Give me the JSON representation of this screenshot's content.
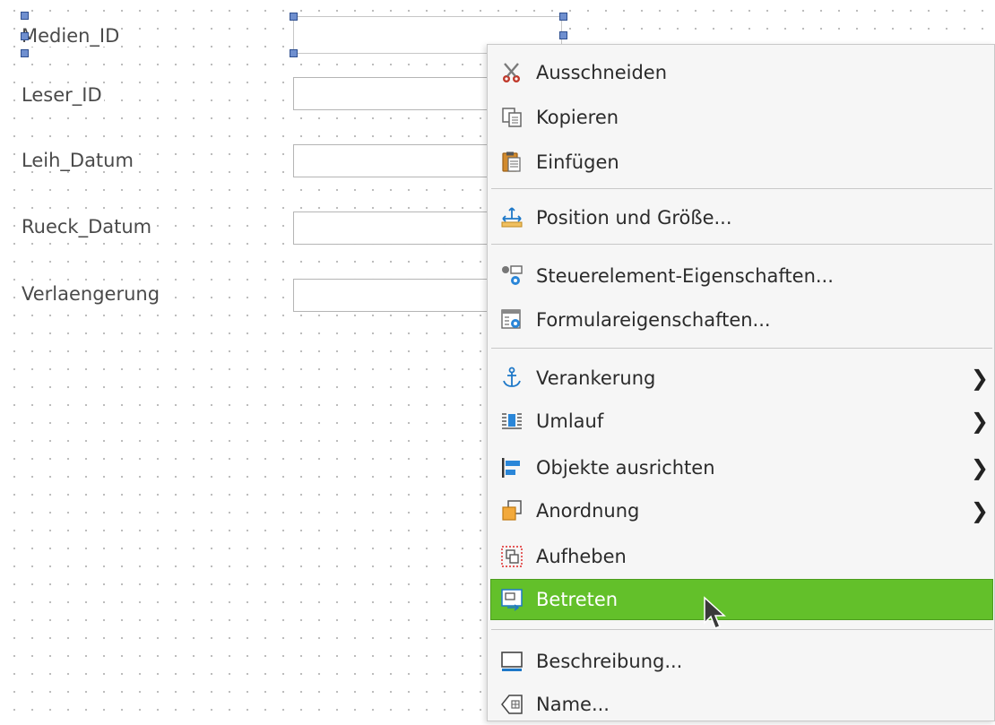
{
  "form": {
    "labels": [
      "Medien_ID",
      "Leser_ID",
      "Leih_Datum",
      "Rueck_Datum",
      "Verlaengerung"
    ]
  },
  "menu": {
    "cut": {
      "label": "Ausschneiden",
      "icon": "scissors-icon"
    },
    "copy": {
      "label": "Kopieren",
      "icon": "copy-icon"
    },
    "paste": {
      "label": "Einfügen",
      "icon": "paste-icon"
    },
    "position_size": {
      "label": "Position und Größe...",
      "icon": "position-size-icon"
    },
    "control_properties": {
      "label": "Steuerelement-Eigenschaften...",
      "icon": "control-properties-icon"
    },
    "form_properties": {
      "label": "Formulareigenschaften...",
      "icon": "form-properties-icon"
    },
    "anchor": {
      "label": "Verankerung",
      "icon": "anchor-icon",
      "submenu": true
    },
    "wrap": {
      "label": "Umlauf",
      "icon": "wrap-icon",
      "submenu": true
    },
    "align": {
      "label": "Objekte ausrichten",
      "icon": "align-objects-icon",
      "submenu": true
    },
    "arrange": {
      "label": "Anordnung",
      "icon": "arrange-icon",
      "submenu": true
    },
    "ungroup": {
      "label": "Aufheben",
      "icon": "ungroup-icon"
    },
    "enter_group": {
      "label": "Betreten",
      "icon": "enter-group-icon",
      "highlighted": true
    },
    "description": {
      "label": "Beschreibung...",
      "icon": "description-icon"
    },
    "name": {
      "label": "Name...",
      "icon": "name-icon"
    }
  },
  "colors": {
    "highlight": "#63c02a",
    "handle": "#6f8fcf"
  }
}
